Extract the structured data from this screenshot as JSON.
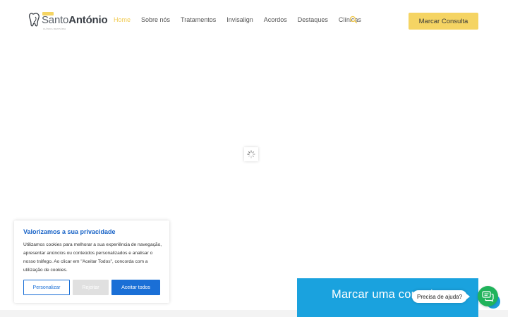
{
  "brand": {
    "name_light": "Santo",
    "name_bold": "António",
    "tagline": "CLÍNICA DENTÁRIA",
    "accent": "#f5d463"
  },
  "nav": {
    "items": [
      "Home",
      "Sobre nós",
      "Tratamentos",
      "Invisalign",
      "Acordos",
      "Destaques",
      "Clínicas"
    ],
    "active": "Home",
    "search_icon": "search-icon"
  },
  "cta": {
    "label": "Marcar Consulta"
  },
  "cookie": {
    "title": "Valorizamos a sua privacidade",
    "body": "Utilizamos cookies para melhorar a sua experiência de navegação, apresentar anúncios ou conteúdos personalizados e analisar o nosso tráfego. Ao clicar em \"Aceitar Todos\", concorda com a utilização de cookies.",
    "customize": "Personalizar",
    "reject": "Rejeitar",
    "accept": "Aceitar todos",
    "primary_color": "#1a6fd6"
  },
  "booking_bar": {
    "label": "Marcar uma consulta"
  },
  "help": {
    "label": "Precisa de ajuda?",
    "icon": "chat-icon",
    "color": "#21b35b"
  },
  "loader": {
    "icon": "spinner-icon"
  }
}
